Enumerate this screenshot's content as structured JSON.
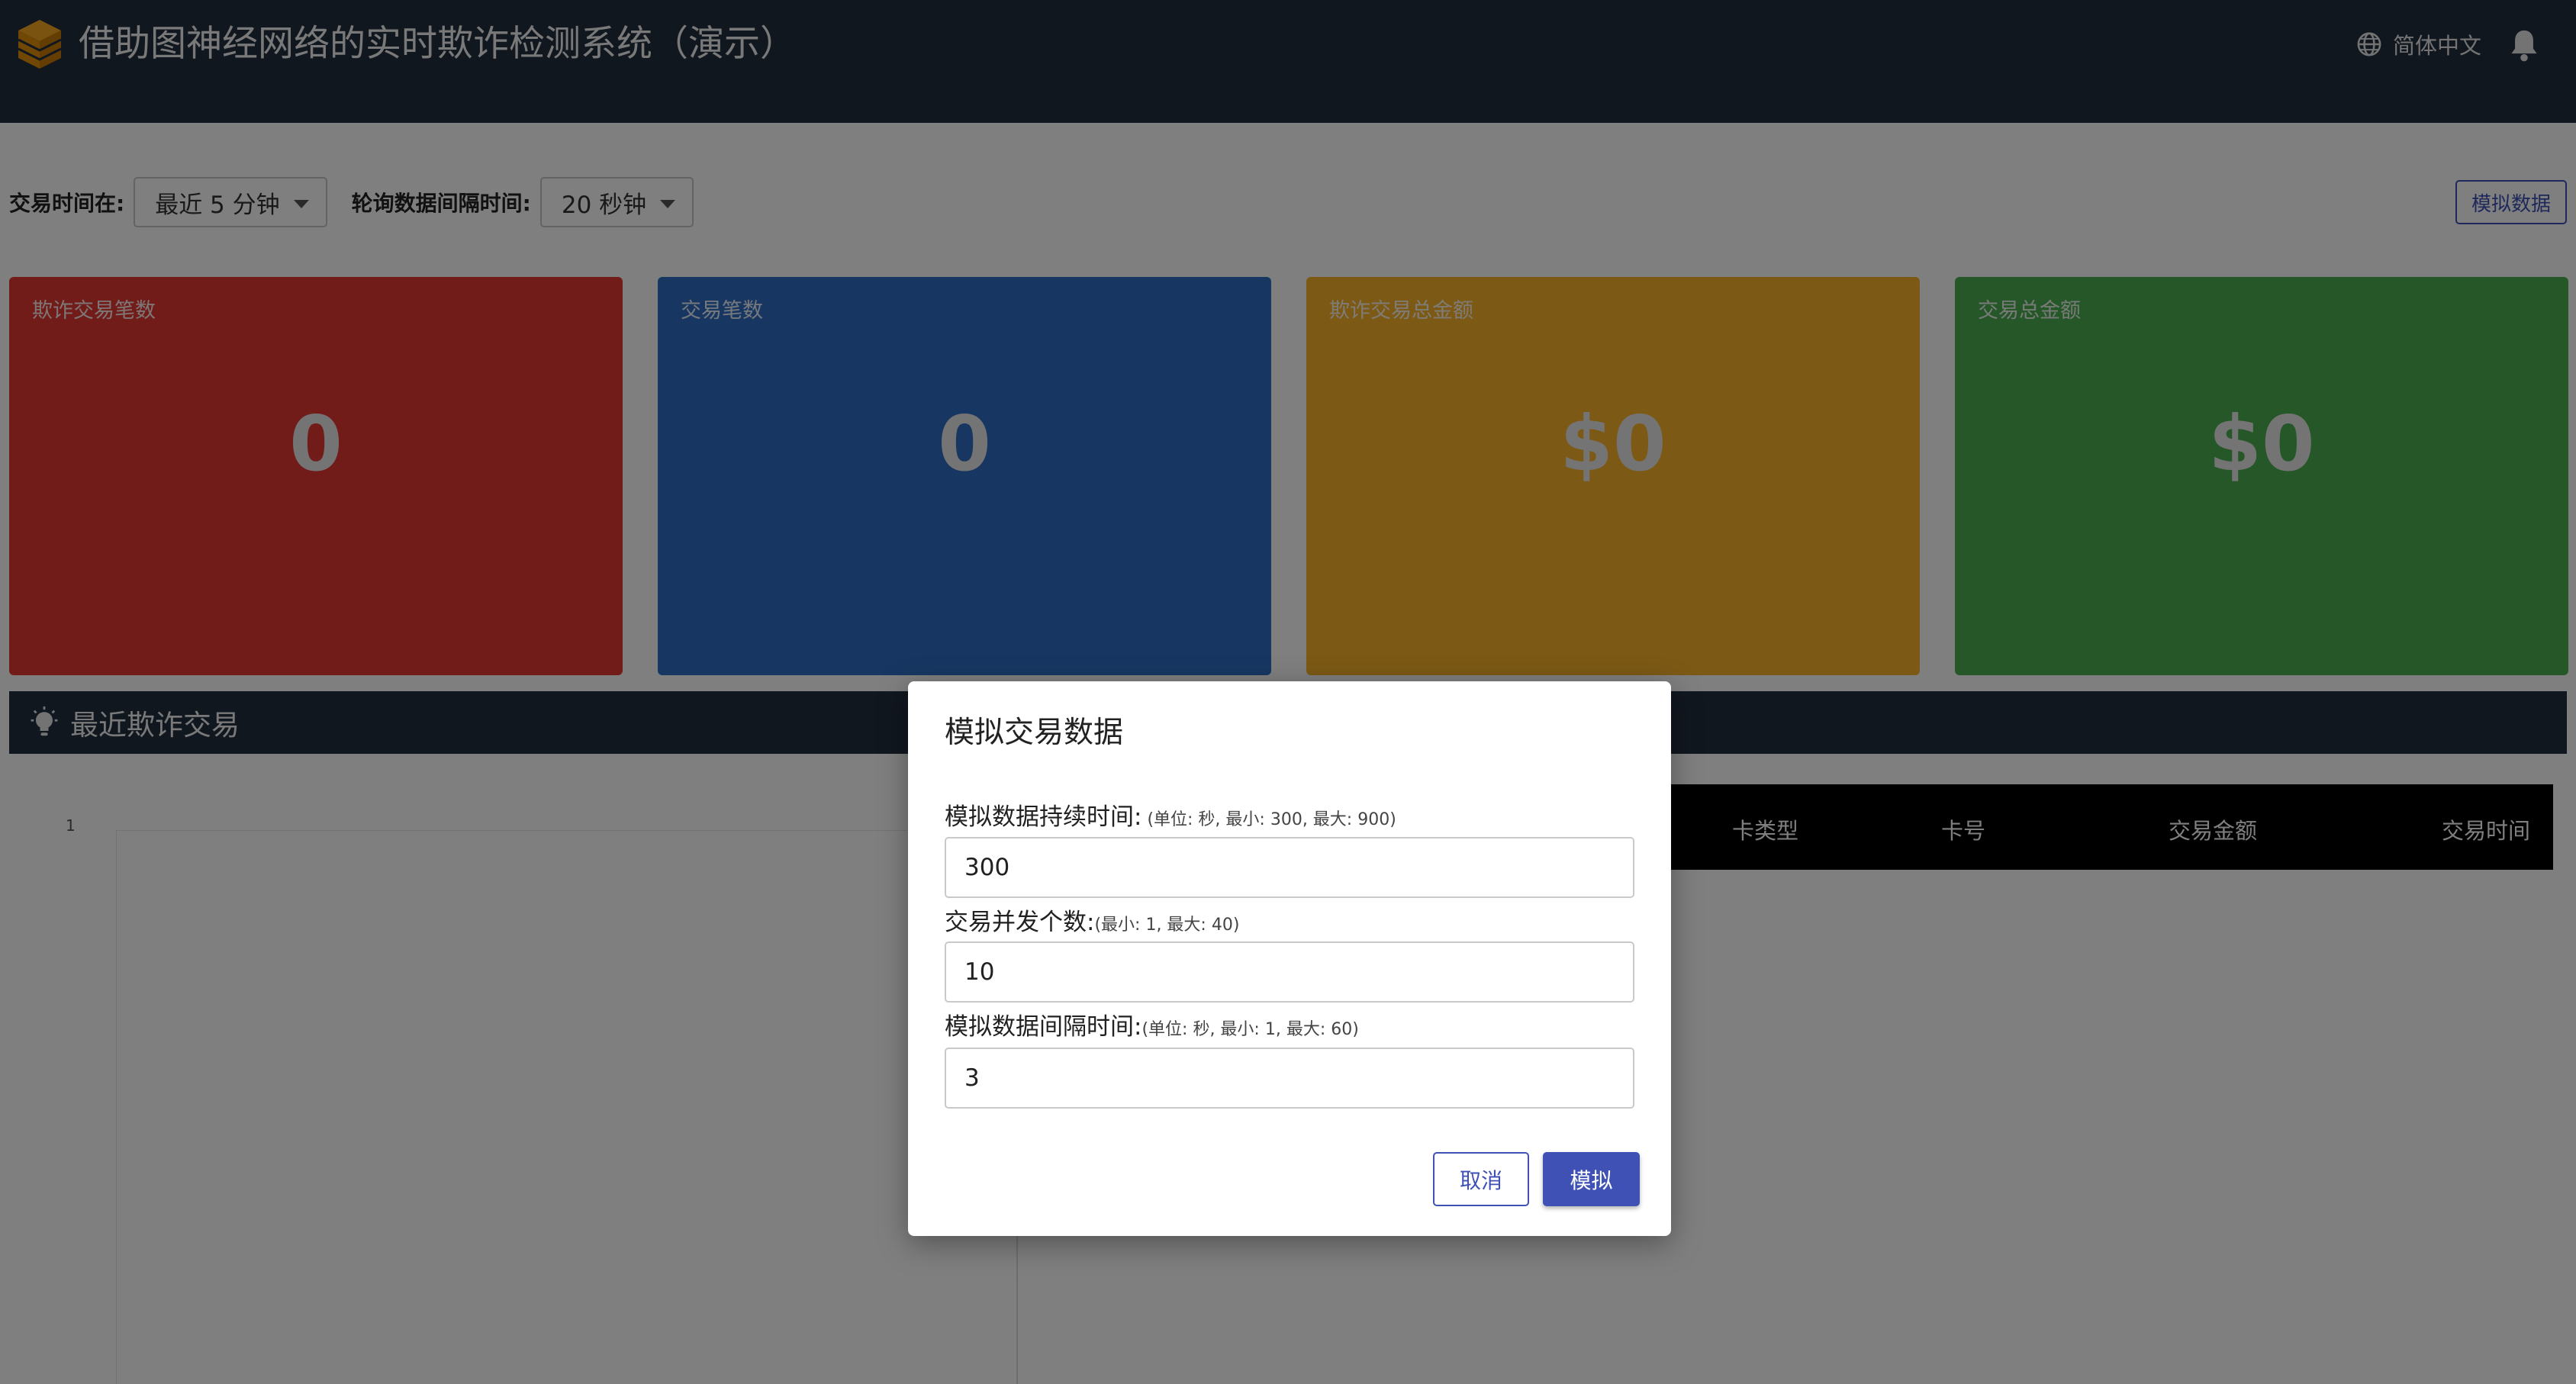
{
  "header": {
    "title": "借助图神经网络的实时欺诈检测系统（演示）",
    "language": "简体中文",
    "logo_icon": "cube-logo-icon",
    "language_icon": "globe-icon",
    "notification_icon": "bell-icon"
  },
  "filters": {
    "time_label": "交易时间在:",
    "time_value": "最近 5 分钟",
    "poll_label": "轮询数据间隔时间:",
    "poll_value": "20 秒钟",
    "simulate_button": "模拟数据"
  },
  "stats": [
    {
      "label": "欺诈交易笔数",
      "value": "0",
      "color": "#e53935"
    },
    {
      "label": "交易笔数",
      "value": "0",
      "color": "#2f6fc4"
    },
    {
      "label": "欺诈交易总金额",
      "value": "$0",
      "color": "#f9b22a"
    },
    {
      "label": "交易总金额",
      "value": "$0",
      "color": "#4caf50"
    }
  ],
  "recent": {
    "title": "最近欺诈交易",
    "icon": "lightbulb-icon",
    "chart_tick": "1",
    "columns": [
      "卡类型",
      "卡号",
      "交易金额",
      "交易时间"
    ]
  },
  "dialog": {
    "title": "模拟交易数据",
    "fields": [
      {
        "label": "模拟数据持续时间:",
        "hint": " (单位: 秒, 最小: 300, 最大: 900)",
        "value": "300"
      },
      {
        "label": "交易并发个数:",
        "hint": "(最小: 1, 最大: 40)",
        "value": "10"
      },
      {
        "label": "模拟数据间隔时间:",
        "hint": "(单位: 秒, 最小: 1, 最大: 60)",
        "value": "3"
      }
    ],
    "cancel_label": "取消",
    "simulate_label": "模拟"
  },
  "colors": {
    "header_bg": "#232f3e",
    "primary": "#3f51b5",
    "overlay": "rgba(0,0,0,0.5)"
  }
}
